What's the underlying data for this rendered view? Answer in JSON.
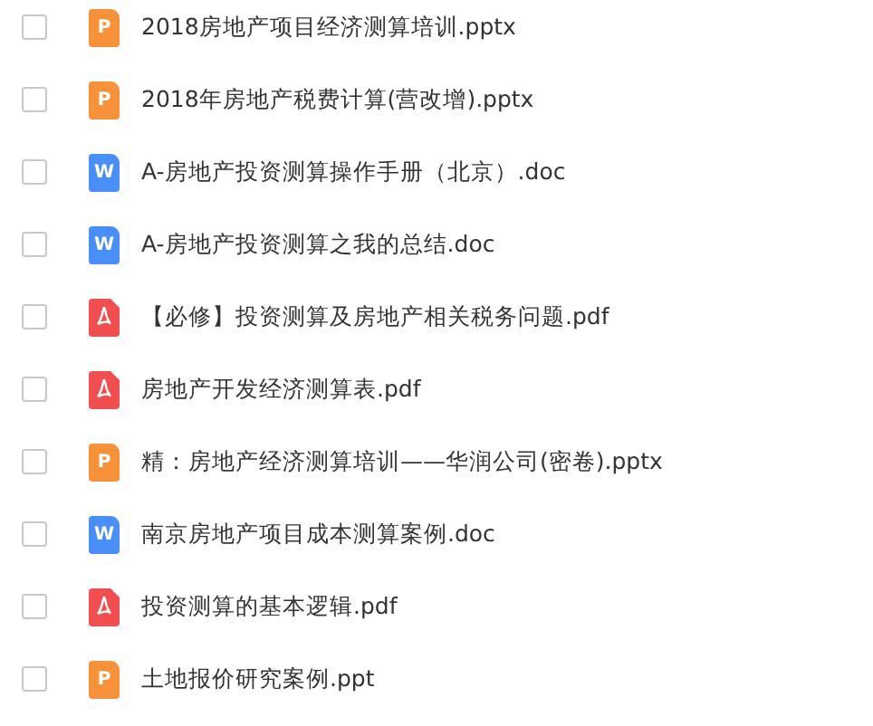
{
  "files": [
    {
      "name": "2018房地产项目经济测算培训.pptx",
      "kind": "ppt",
      "badge": "P",
      "checked": false
    },
    {
      "name": "2018年房地产税费计算(营改增).pptx",
      "kind": "ppt",
      "badge": "P",
      "checked": false
    },
    {
      "name": "A-房地产投资测算操作手册（北京）.doc",
      "kind": "doc",
      "badge": "W",
      "checked": false
    },
    {
      "name": "A-房地产投资测算之我的总结.doc",
      "kind": "doc",
      "badge": "W",
      "checked": false
    },
    {
      "name": "【必修】投资测算及房地产相关税务问题.pdf",
      "kind": "pdf",
      "checked": false
    },
    {
      "name": "房地产开发经济测算表.pdf",
      "kind": "pdf",
      "checked": false
    },
    {
      "name": "精：房地产经济测算培训——华润公司(密卷).pptx",
      "kind": "ppt",
      "badge": "P",
      "checked": false
    },
    {
      "name": "南京房地产项目成本测算案例.doc",
      "kind": "doc",
      "badge": "W",
      "checked": false
    },
    {
      "name": "投资测算的基本逻辑.pdf",
      "kind": "pdf",
      "checked": false
    },
    {
      "name": "土地报价研究案例.ppt",
      "kind": "ppt",
      "badge": "P",
      "checked": false
    }
  ]
}
